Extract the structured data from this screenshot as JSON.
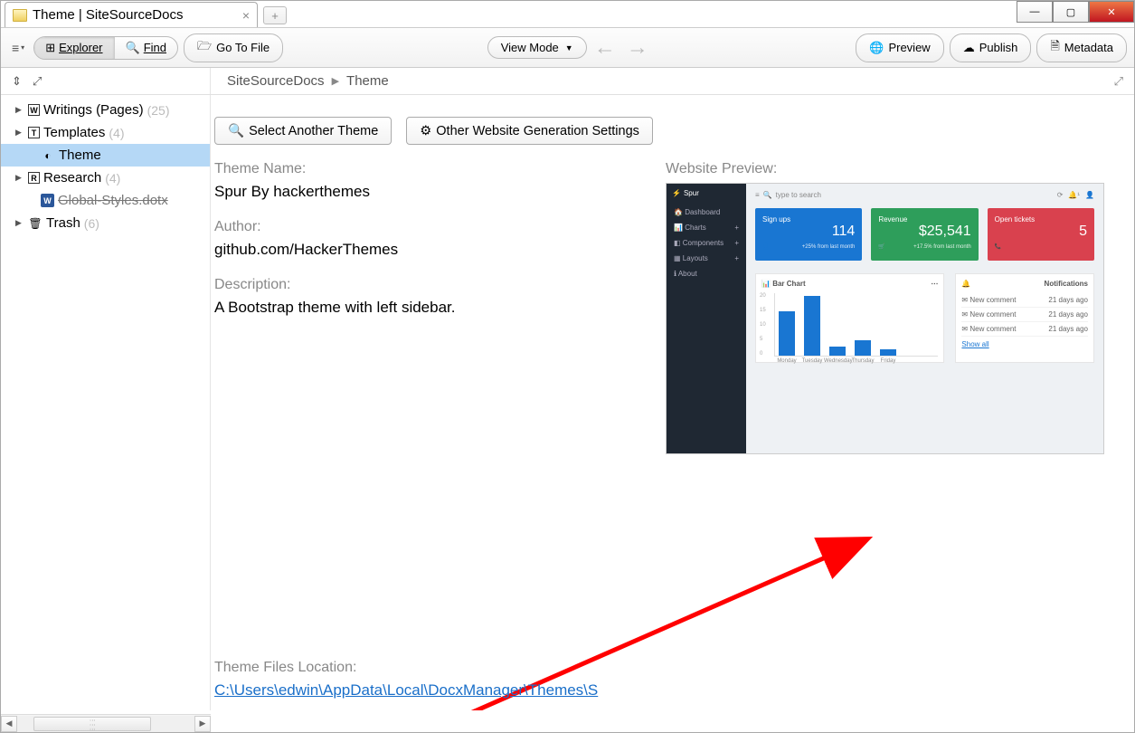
{
  "window_title": "Theme | SiteSourceDocs",
  "toolbar": {
    "explorer": "Explorer",
    "find": "Find",
    "goto": "Go To File",
    "viewmode": "View Mode",
    "preview": "Preview",
    "publish": "Publish",
    "metadata": "Metadata"
  },
  "breadcrumb": {
    "root": "SiteSourceDocs",
    "current": "Theme"
  },
  "tree": {
    "writings": {
      "label": "Writings (Pages)",
      "count": "(25)"
    },
    "templates": {
      "label": "Templates",
      "count": "(4)"
    },
    "theme": {
      "label": "Theme"
    },
    "research": {
      "label": "Research",
      "count": "(4)"
    },
    "global_styles": {
      "label": "Global-Styles.dotx"
    },
    "trash": {
      "label": "Trash",
      "count": "(6)"
    }
  },
  "buttons": {
    "select_theme": "Select Another Theme",
    "other_settings": "Other Website Generation Settings"
  },
  "fields": {
    "theme_name_label": "Theme Name:",
    "theme_name_value": "Spur By hackerthemes",
    "author_label": "Author:",
    "author_value": "github.com/HackerThemes",
    "description_label": "Description:",
    "description_value": "A Bootstrap theme with left sidebar.",
    "preview_label": "Website Preview:",
    "location_label": "Theme Files Location:",
    "location_value": "C:\\Users\\edwin\\AppData\\Local\\DocxManager\\Themes\\S"
  },
  "preview": {
    "brand": "Spur",
    "menu": [
      "Dashboard",
      "Charts",
      "Components",
      "Layouts",
      "About"
    ],
    "search_placeholder": "type to search",
    "cards": {
      "signups": {
        "title": "Sign ups",
        "value": "114",
        "sub": "+25% from last month"
      },
      "revenue": {
        "title": "Revenue",
        "value": "$25,541",
        "sub": "+17.5% from last month"
      },
      "tickets": {
        "title": "Open tickets",
        "value": "5"
      }
    },
    "chart_title": "Bar Chart",
    "notif_title": "Notifications",
    "notif_item": "New comment",
    "notif_time": "21 days ago",
    "show_all": "Show all"
  },
  "chart_data": {
    "type": "bar",
    "categories": [
      "Monday",
      "Tuesday",
      "Wednesday",
      "Thursday",
      "Friday"
    ],
    "values": [
      14,
      19,
      3,
      5,
      2
    ],
    "y_ticks": [
      "20",
      "15",
      "10",
      "5",
      "0"
    ],
    "ylim": [
      0,
      20
    ]
  }
}
